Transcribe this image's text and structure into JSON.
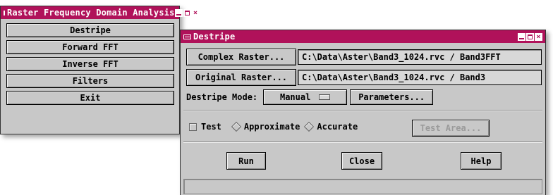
{
  "main_window": {
    "title": "Raster Frequency Domain Analysis",
    "buttons": [
      "Destripe",
      "Forward FFT",
      "Inverse FFT",
      "Filters",
      "Exit"
    ]
  },
  "destripe_dialog": {
    "title": "Destripe",
    "complex_raster_button": "Complex Raster...",
    "complex_raster_value": "C:\\Data\\Aster\\Band3_1024.rvc / Band3FFT",
    "original_raster_button": "Original Raster...",
    "original_raster_value": "C:\\Data\\Aster\\Band3_1024.rvc / Band3",
    "mode_label": "Destripe Mode:",
    "mode_value": "Manual",
    "parameters_button": "Parameters...",
    "test_label": "Test",
    "approximate_label": "Approximate",
    "accurate_label": "Accurate",
    "test_area_button": "Test Area...",
    "run_button": "Run",
    "close_button": "Close",
    "help_button": "Help",
    "status_text": ""
  },
  "colors": {
    "titlebar": "#b0125a",
    "window_bg": "#c8c8c8"
  }
}
